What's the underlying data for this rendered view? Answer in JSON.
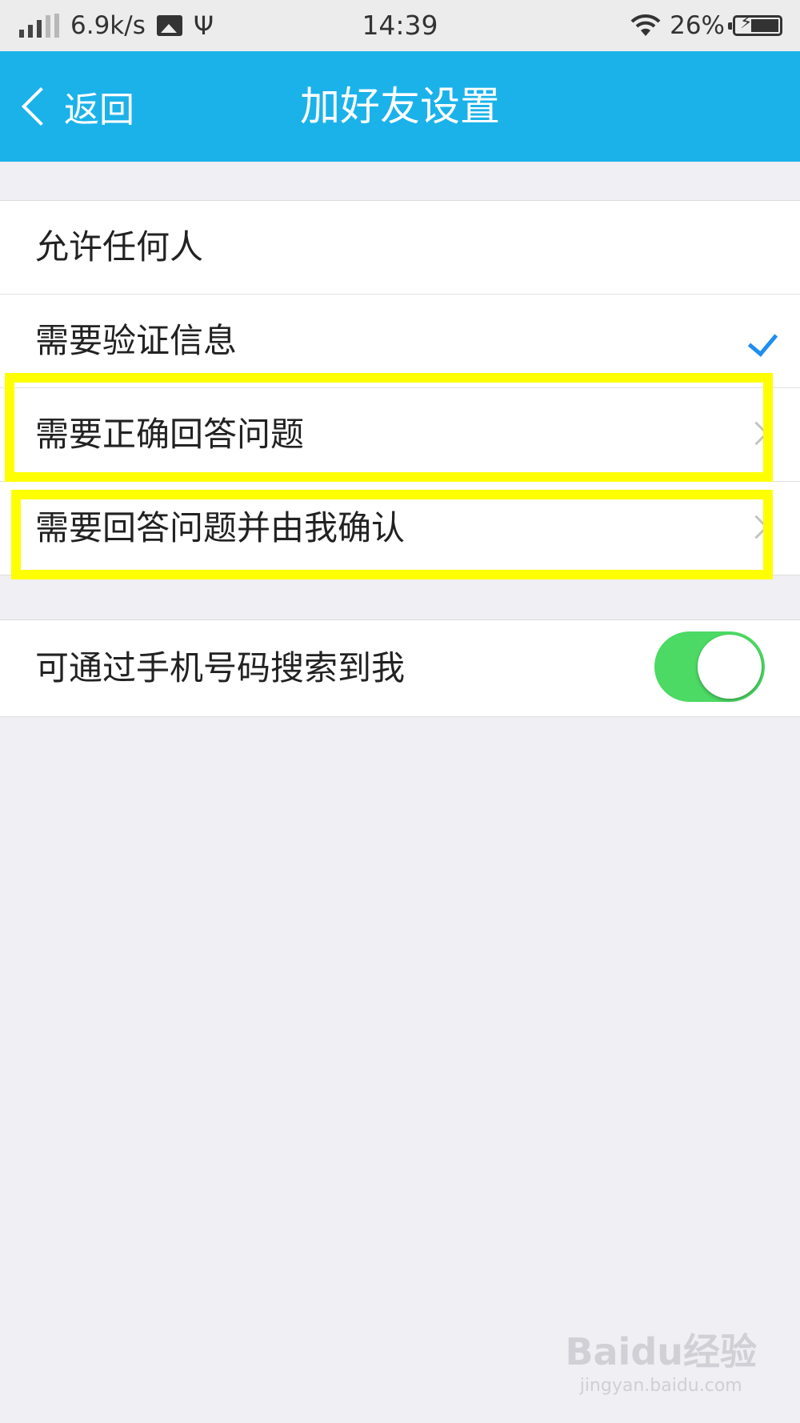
{
  "status_bar": {
    "net_speed": "6.9k/s",
    "time": "14:39",
    "battery_pct": "26%"
  },
  "nav": {
    "back_label": "返回",
    "title": "加好友设置"
  },
  "verify_options": [
    {
      "label": "允许任何人",
      "selected": false,
      "has_chevron": false
    },
    {
      "label": "需要验证信息",
      "selected": true,
      "has_chevron": false
    },
    {
      "label": "需要正确回答问题",
      "selected": false,
      "has_chevron": true
    },
    {
      "label": "需要回答问题并由我确认",
      "selected": false,
      "has_chevron": true
    }
  ],
  "phone_search": {
    "label": "可通过手机号码搜索到我",
    "enabled": true
  },
  "watermark": {
    "logo": "Baidu经验",
    "url": "jingyan.baidu.com"
  },
  "colors": {
    "nav_bar": "#1bb2ea",
    "check": "#1f8ef1",
    "toggle_on": "#4cd964",
    "highlight": "#ffff00",
    "background": "#efeff4"
  },
  "icons": [
    "signal-icon",
    "gallery-icon",
    "usb-icon",
    "wifi-icon",
    "battery-icon",
    "back-chevron-icon",
    "check-icon",
    "chevron-right-icon"
  ]
}
